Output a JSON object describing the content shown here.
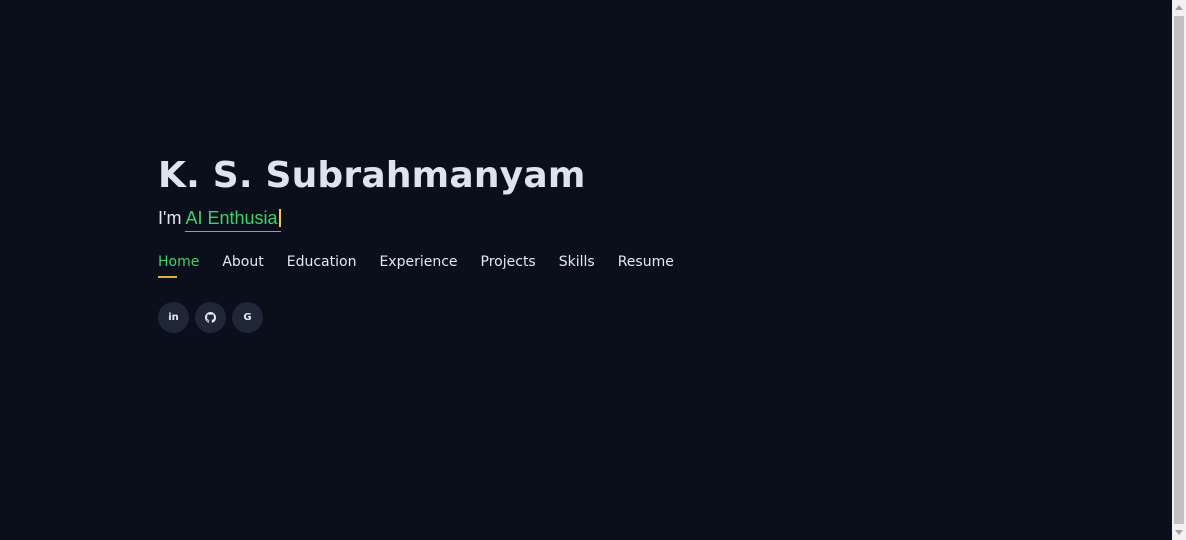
{
  "hero": {
    "name": "K. S. Subrahmanyam",
    "tagline_prefix": "I'm ",
    "tagline_typed": "AI Enthusia"
  },
  "nav": {
    "items": [
      {
        "label": "Home",
        "active": true
      },
      {
        "label": "About",
        "active": false
      },
      {
        "label": "Education",
        "active": false
      },
      {
        "label": "Experience",
        "active": false
      },
      {
        "label": "Projects",
        "active": false
      },
      {
        "label": "Skills",
        "active": false
      },
      {
        "label": "Resume",
        "active": false
      }
    ]
  },
  "social": {
    "linkedin_label": "in",
    "github_icon": "github-icon",
    "google_label": "G"
  },
  "colors": {
    "background": "#0b0f1c",
    "accent_green": "#3fd16a",
    "underline_gold": "#e0b23a",
    "text_light": "#e4e7ef",
    "social_bg": "#1f2637"
  }
}
